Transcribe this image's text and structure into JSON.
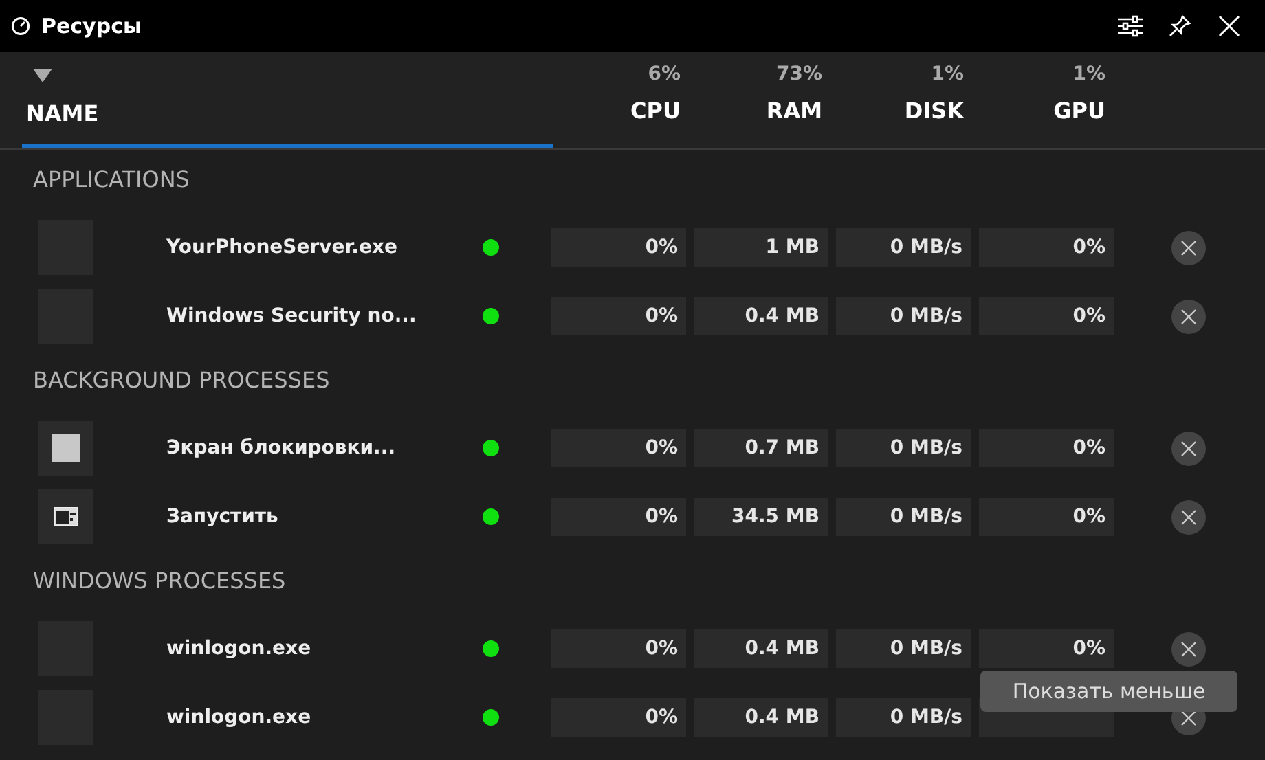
{
  "window": {
    "title": "Ресурсы"
  },
  "columns": [
    {
      "label": "NAME",
      "selected": true
    },
    {
      "label": "CPU",
      "usage": "6%",
      "selected": false
    },
    {
      "label": "RAM",
      "usage": "73%",
      "selected": false
    },
    {
      "label": "DISK",
      "usage": "1%",
      "selected": false
    },
    {
      "label": "GPU",
      "usage": "1%",
      "selected": false
    }
  ],
  "sections": [
    {
      "title": "APPLICATIONS",
      "rows": [
        {
          "name": "YourPhoneServer.exe",
          "kind": "blank",
          "cpu": "0%",
          "ram": "1 MB",
          "disk": "0 MB/s",
          "gpu": "0%"
        },
        {
          "name": "Windows Security no...",
          "kind": "blank",
          "cpu": "0%",
          "ram": "0.4 MB",
          "disk": "0 MB/s",
          "gpu": "0%"
        }
      ]
    },
    {
      "title": "BACKGROUND PROCESSES",
      "rows": [
        {
          "name": "Экран блокировки...",
          "kind": "square",
          "cpu": "0%",
          "ram": "0.7 MB",
          "disk": "0 MB/s",
          "gpu": "0%"
        },
        {
          "name": "Запустить",
          "kind": "window",
          "cpu": "0%",
          "ram": "34.5 MB",
          "disk": "0 MB/s",
          "gpu": "0%"
        }
      ]
    },
    {
      "title": "WINDOWS PROCESSES",
      "rows": [
        {
          "name": "winlogon.exe",
          "kind": "blank",
          "cpu": "0%",
          "ram": "0.4 MB",
          "disk": "0 MB/s",
          "gpu": "0%"
        },
        {
          "name": "winlogon.exe",
          "kind": "blank",
          "cpu": "0%",
          "ram": "0.4 MB",
          "disk": "0 MB/s"
        }
      ]
    }
  ],
  "tooltip": "Показать меньше"
}
